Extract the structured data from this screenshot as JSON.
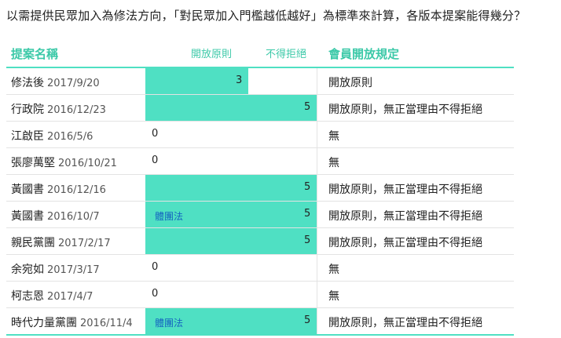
{
  "question": "以需提供民眾加入為修法方向，「對民眾加入門檻越低越好」為標準來計算，各版本提案能得幾分？",
  "headers": {
    "name": "提案名稱",
    "open": "開放原則",
    "reject": "不得拒絕",
    "rule": "會員開放規定"
  },
  "chart_data": {
    "type": "bar",
    "orientation": "horizontal",
    "xlim": [
      0,
      5
    ],
    "categories": [
      "修法後",
      "行政院",
      "江啟臣",
      "張廖萬堅",
      "黃國書",
      "黃國書",
      "親民黨團",
      "余宛如",
      "柯志恩",
      "時代力量黨團"
    ],
    "rows": [
      {
        "name": "修法後",
        "date": "2017/9/20",
        "value": 3,
        "value_label": "3",
        "note": "",
        "rule": "開放原則"
      },
      {
        "name": "行政院",
        "date": "2016/12/23",
        "value": 5,
        "value_label": "5",
        "note": "",
        "rule": "開放原則，無正當理由不得拒絕"
      },
      {
        "name": "江啟臣",
        "date": "2016/5/6",
        "value": 0,
        "value_label": "0",
        "note": "",
        "rule": "無"
      },
      {
        "name": "張廖萬堅",
        "date": "2016/10/21",
        "value": 0,
        "value_label": "0",
        "note": "",
        "rule": "無"
      },
      {
        "name": "黃國書",
        "date": "2016/12/16",
        "value": 5,
        "value_label": "5",
        "note": "",
        "rule": "開放原則，無正當理由不得拒絕"
      },
      {
        "name": "黃國書",
        "date": "2016/10/7",
        "value": 5,
        "value_label": "5",
        "note": "體團法",
        "rule": "開放原則，無正當理由不得拒絕"
      },
      {
        "name": "親民黨團",
        "date": "2017/2/17",
        "value": 5,
        "value_label": "5",
        "note": "",
        "rule": "開放原則，無正當理由不得拒絕"
      },
      {
        "name": "余宛如",
        "date": "2017/3/17",
        "value": 0,
        "value_label": "0",
        "note": "",
        "rule": "無"
      },
      {
        "name": "柯志恩",
        "date": "2017/4/7",
        "value": 0,
        "value_label": "0",
        "note": "",
        "rule": "無"
      },
      {
        "name": "時代力量黨團",
        "date": "2016/11/4",
        "value": 5,
        "value_label": "5",
        "note": "體團法",
        "rule": "開放原則，無正當理由不得拒絕"
      }
    ]
  },
  "colors": {
    "bar": "#4fe0c3",
    "header_text": "#3cc9a8",
    "note_text": "#1565c0"
  }
}
